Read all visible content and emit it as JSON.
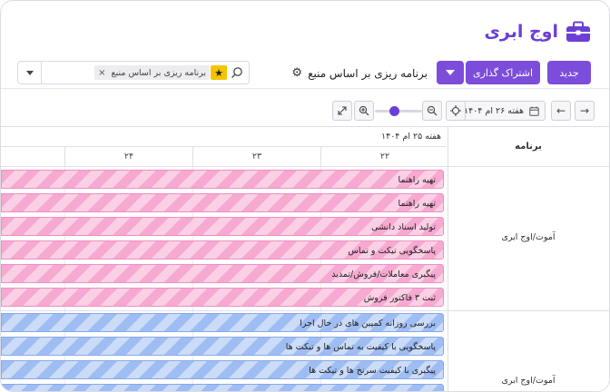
{
  "brand": {
    "name": "اوج ابری",
    "color": "#6b3fd6"
  },
  "toolbar": {
    "new_label": "جدید",
    "share_label": "اشتراک گذاری",
    "view_title": "برنامه ریزی بر اساس منبع"
  },
  "search": {
    "facet_label": "برنامه ریزی بر اساس منبع",
    "placeholder": ""
  },
  "gantt_toolbar": {
    "date_label": "هفته ۲۶ ام ۱۴۰۴"
  },
  "gantt": {
    "label_column_header": "برنامه",
    "week_header": "هفته ۲۵ ام ۱۴۰۴",
    "days": [
      "۲۲",
      "۲۳",
      "۲۴"
    ],
    "groups": [
      {
        "label": "آموت/اوج ابری",
        "color": "pink",
        "tasks": [
          "تهیه راهنما",
          "تهیه راهنما",
          "تولید اسناد دانشی",
          "پاسخگویی تیکت و تماس",
          "پیگیری معاملات/فروش/تمدید",
          "ثبت ۳ فاکتور فروش"
        ]
      },
      {
        "label": "آموت/اوج ابری",
        "color": "blue",
        "tasks": [
          "بررسی روزانه کمپین های در حال اجرا",
          "پاسخگویی با کیفیت به تماس ها و تیکت ها",
          "پیگیری با کیفیت سرنخ ها و تیکت ها",
          "..."
        ]
      }
    ]
  }
}
